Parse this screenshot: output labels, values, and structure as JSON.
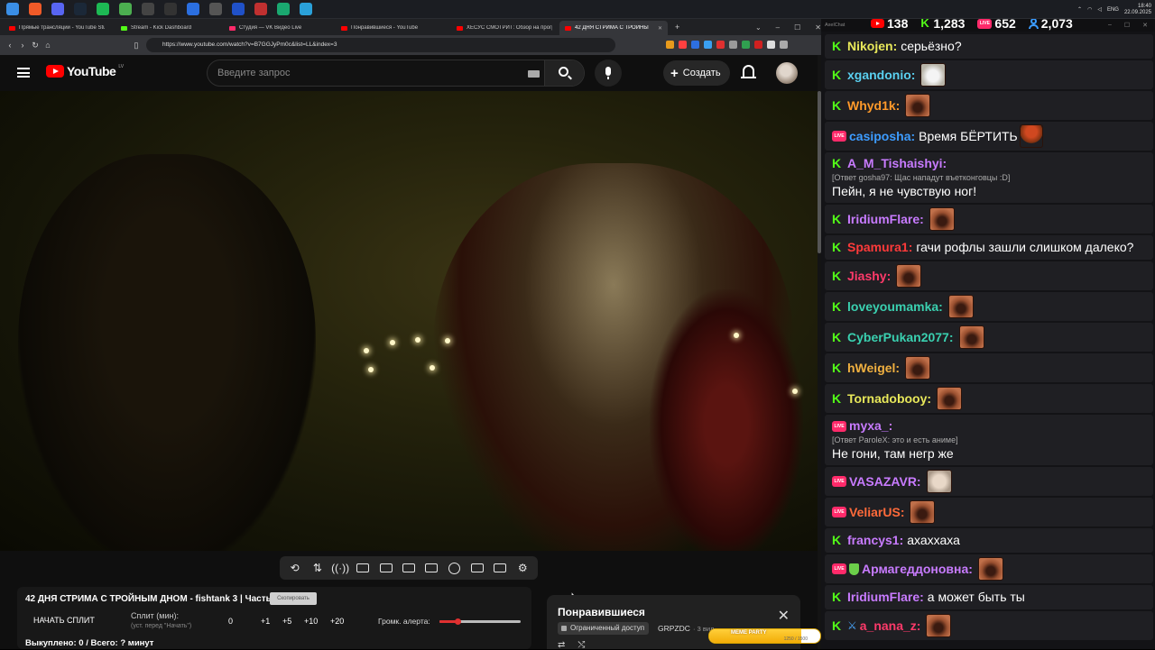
{
  "taskbar": {
    "apps": [
      {
        "name": "windows-start-icon",
        "color": "#3a8ee6"
      },
      {
        "name": "brave-icon",
        "color": "#f05a28"
      },
      {
        "name": "discord-icon",
        "color": "#5865f2"
      },
      {
        "name": "steam-icon",
        "color": "#1b2838"
      },
      {
        "name": "spotify-icon",
        "color": "#1db954"
      },
      {
        "name": "chrome-icon",
        "color": "#4caf50"
      },
      {
        "name": "obs-icon",
        "color": "#444"
      },
      {
        "name": "capcut-icon",
        "color": "#333"
      },
      {
        "name": "app-blue-icon",
        "color": "#2b6fe0"
      },
      {
        "name": "app-arrow-icon",
        "color": "#555"
      },
      {
        "name": "app-play-icon",
        "color": "#2051c8"
      },
      {
        "name": "app-red-icon",
        "color": "#c03030"
      },
      {
        "name": "app-green-icon",
        "color": "#1aa870"
      },
      {
        "name": "telegram-icon",
        "color": "#2aa1da"
      }
    ],
    "lang": "ENG",
    "time": "18:40",
    "date": "22.09.2025"
  },
  "tabs": [
    {
      "label": "Прямые трансляции - YouTube Stu",
      "fav": "#ff0000"
    },
    {
      "label": "Stream - Kick Dashboard",
      "fav": "#53fc18"
    },
    {
      "label": "Студия — VK Видео Live",
      "fav": "#ff2a6a"
    },
    {
      "label": "Понравившиеся - YouTube",
      "fav": "#ff0000"
    },
    {
      "label": "ХЕСУС СМОТРИТ: Обзор на прогр",
      "fav": "#ff0000"
    },
    {
      "label": "42 ДНЯ СТРИМА С ТРОЙНЫ",
      "fav": "#ff0000"
    }
  ],
  "url": "https://www.youtube.com/watch?v=B7GGJyPm0c&list=LL&index=3",
  "youtube": {
    "logo": "YouTube",
    "country": "LV",
    "search_placeholder": "Введите запрос",
    "create_label": "Создать"
  },
  "panel": {
    "title": "42 ДНЯ СТРИМА С ТРОЙНЫМ ДНОМ - fishtank 3 | Часть 2",
    "copy_btn": "Скопировать",
    "start_split": "НАЧАТЬ СПЛИТ",
    "split_label": "Сплит (мин):",
    "split_hint": "(уст. перед \"Начать\")",
    "value": "0",
    "inc": [
      "+1",
      "+5",
      "+10",
      "+20"
    ],
    "alert_label": "Громк. алерта:",
    "alert_volume": 0.22,
    "bought": "Выкуплено: 0 / Всего: ? минут"
  },
  "liked": {
    "title": "Понравившиеся",
    "badge": "Ограниченный доступ",
    "owner": "GRPZDC",
    "views": "· 3 вид"
  },
  "meme": {
    "label": "MEME PARTY",
    "count": "1250 / 1500",
    "progress": 0.83
  },
  "chat": {
    "window_title": "AxelChat",
    "stats": {
      "youtube": "138",
      "kick": "1,283",
      "vk": "652",
      "total": "2,073"
    },
    "messages": [
      {
        "plat": "kick",
        "user": "Nikojen:",
        "color": "#e8e85a",
        "text": "серьёзно?",
        "emote": ""
      },
      {
        "plat": "kick",
        "user": "xgandonio:",
        "color": "#5ad0f0",
        "text": "",
        "emote": "cat"
      },
      {
        "plat": "kick",
        "user": "Whyd1k:",
        "color": "#ff9a2a",
        "text": "",
        "emote": "face"
      },
      {
        "plat": "vk",
        "user": "casiposha:",
        "color": "#3d9cff",
        "text": "Время БЁРТИТЬ",
        "emote": "mush"
      },
      {
        "plat": "kick",
        "user": "A_M_Tishaishyi:",
        "color": "#c87bff",
        "text": "Пейн, я не чувствую ног!",
        "reply": "[Ответ gosha97: Щас нападут въетконговцы :D]",
        "emote": ""
      },
      {
        "plat": "kick",
        "user": "IridiumFlare:",
        "color": "#c87bff",
        "text": "",
        "emote": "face"
      },
      {
        "plat": "kick",
        "user": "Spamura1:",
        "color": "#ff3a3a",
        "text": "гачи рофлы зашли слишком далеко?",
        "emote": ""
      },
      {
        "plat": "kick",
        "user": "Jiashy:",
        "color": "#ff3a6a",
        "text": "",
        "emote": "face"
      },
      {
        "plat": "kick",
        "user": "loveyoumamka:",
        "color": "#3ad0b0",
        "text": "",
        "emote": "face"
      },
      {
        "plat": "kick",
        "user": "CyberPukan2077:",
        "color": "#3ad0b0",
        "text": "",
        "emote": "face"
      },
      {
        "plat": "kick",
        "user": "hWeigel:",
        "color": "#f0b040",
        "text": "",
        "emote": "face"
      },
      {
        "plat": "kick",
        "user": "Tornadobooy:",
        "color": "#e8e85a",
        "text": "",
        "emote": "face"
      },
      {
        "plat": "vk",
        "user": "myxa_:",
        "color": "#c87bff",
        "text": "Не гони, там негр же",
        "reply": "[Ответ ParoleX: это и есть аниме]",
        "emote": ""
      },
      {
        "plat": "vk",
        "user": "VASAZAVR:",
        "color": "#c87bff",
        "text": "",
        "emote": "pale"
      },
      {
        "plat": "vk",
        "user": "VeliarUS:",
        "color": "#ff6a3a",
        "text": "",
        "emote": "face"
      },
      {
        "plat": "kick",
        "user": "francys1:",
        "color": "#c87bff",
        "text": "ахаххаха",
        "emote": ""
      },
      {
        "plat": "vk",
        "user": "Армагеддоновна:",
        "color": "#c87bff",
        "text": "",
        "emote": "face",
        "shield": true
      },
      {
        "plat": "kick",
        "user": "IridiumFlare:",
        "color": "#c87bff",
        "text": "а может быть ты",
        "emote": ""
      },
      {
        "plat": "kick",
        "user": "a_nana_z:",
        "color": "#ff3a6a",
        "text": "",
        "emote": "face",
        "sword": true
      }
    ]
  }
}
